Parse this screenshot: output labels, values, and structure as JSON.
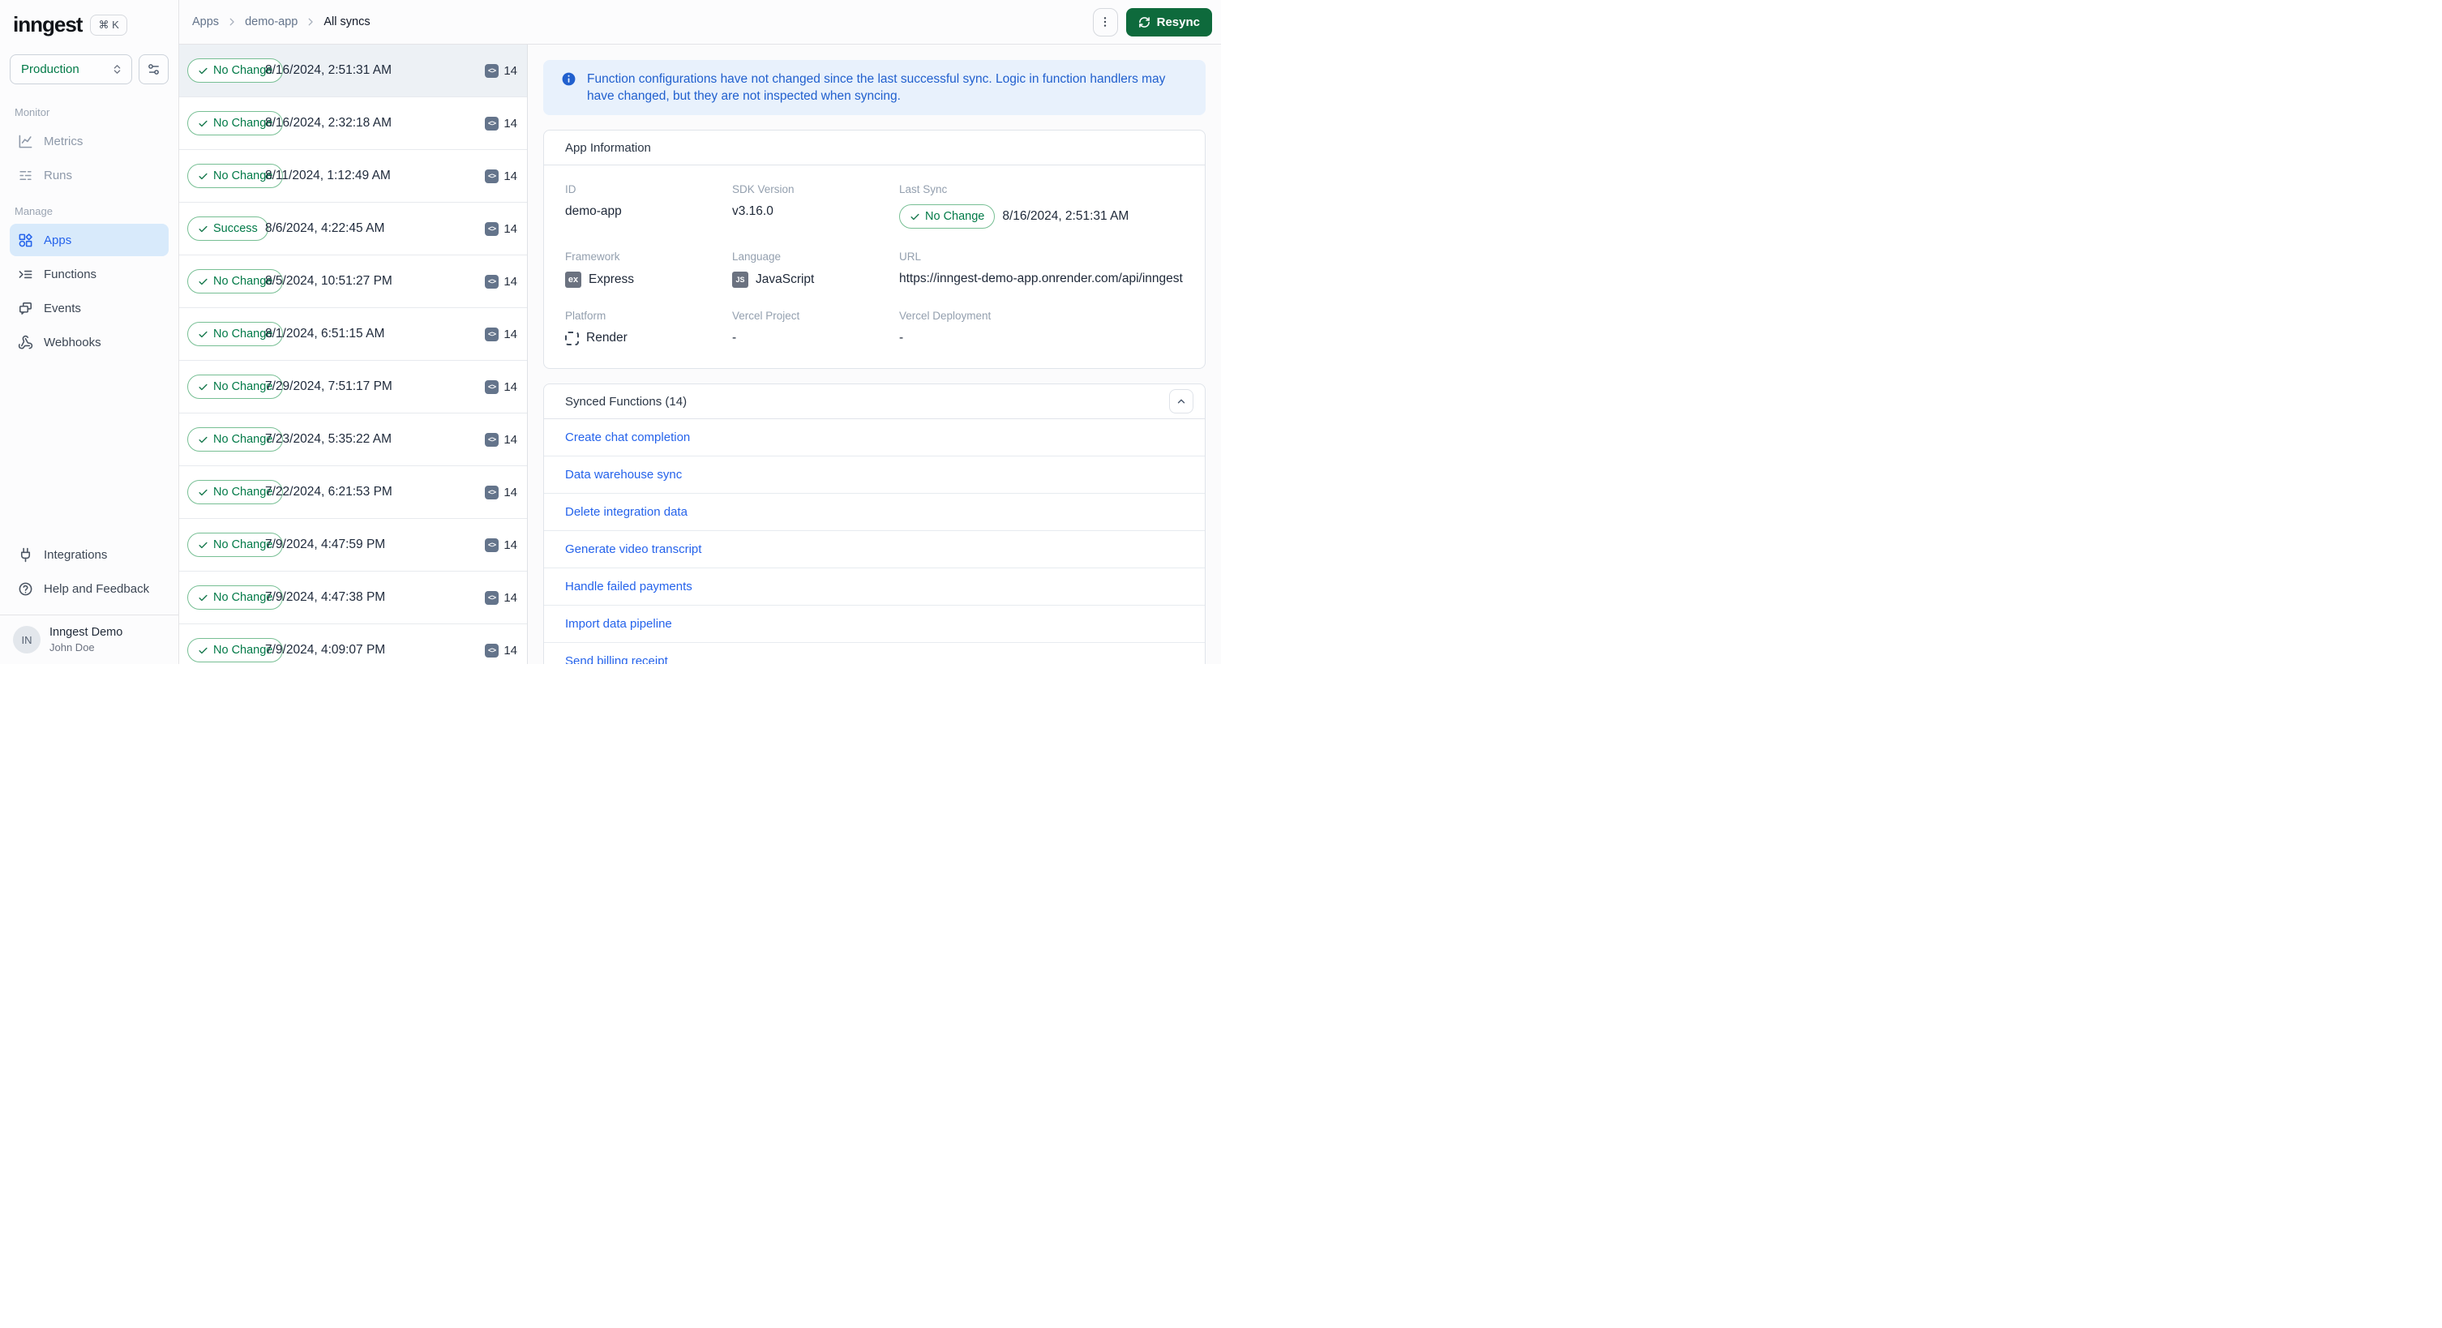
{
  "brand": {
    "logo": "inngest",
    "shortcut": "⌘ K"
  },
  "env": {
    "value": "Production"
  },
  "colors": {
    "brand_green": "#0e6a3c",
    "success_green": "#027a48",
    "active_blue": "#2563eb",
    "banner_blue": "#2160ce",
    "selected_row": "#edf1f5"
  },
  "sidebar": {
    "sections": [
      {
        "label": "Monitor",
        "items": [
          {
            "label": "Metrics",
            "icon": "metrics-icon"
          },
          {
            "label": "Runs",
            "icon": "runs-icon"
          }
        ]
      },
      {
        "label": "Manage",
        "items": [
          {
            "label": "Apps",
            "icon": "apps-icon",
            "active": true
          },
          {
            "label": "Functions",
            "icon": "functions-icon"
          },
          {
            "label": "Events",
            "icon": "events-icon"
          },
          {
            "label": "Webhooks",
            "icon": "webhook-icon"
          }
        ]
      }
    ],
    "footer_items": [
      {
        "label": "Integrations",
        "icon": "plug-icon"
      },
      {
        "label": "Help and Feedback",
        "icon": "help-icon"
      }
    ],
    "profile": {
      "initials": "IN",
      "org": "Inngest Demo",
      "user": "John Doe"
    }
  },
  "breadcrumb": {
    "items": [
      "Apps",
      "demo-app",
      "All syncs"
    ]
  },
  "actions": {
    "resync": "Resync"
  },
  "glyphs": {
    "code": "<>",
    "express": "ex",
    "js": "JS"
  },
  "syncs": [
    {
      "status": "No Change",
      "timestamp": "8/16/2024, 2:51:31 AM",
      "count": "14"
    },
    {
      "status": "No Change",
      "timestamp": "8/16/2024, 2:32:18 AM",
      "count": "14"
    },
    {
      "status": "No Change",
      "timestamp": "8/11/2024, 1:12:49 AM",
      "count": "14"
    },
    {
      "status": "Success",
      "timestamp": "8/6/2024, 4:22:45 AM",
      "count": "14"
    },
    {
      "status": "No Change",
      "timestamp": "8/5/2024, 10:51:27 PM",
      "count": "14"
    },
    {
      "status": "No Change",
      "timestamp": "8/1/2024, 6:51:15 AM",
      "count": "14"
    },
    {
      "status": "No Change",
      "timestamp": "7/29/2024, 7:51:17 PM",
      "count": "14"
    },
    {
      "status": "No Change",
      "timestamp": "7/23/2024, 5:35:22 AM",
      "count": "14"
    },
    {
      "status": "No Change",
      "timestamp": "7/22/2024, 6:21:53 PM",
      "count": "14"
    },
    {
      "status": "No Change",
      "timestamp": "7/9/2024, 4:47:59 PM",
      "count": "14"
    },
    {
      "status": "No Change",
      "timestamp": "7/9/2024, 4:47:38 PM",
      "count": "14"
    },
    {
      "status": "No Change",
      "timestamp": "7/9/2024, 4:09:07 PM",
      "count": "14"
    }
  ],
  "banner": {
    "text": "Function configurations have not changed since the last successful sync. Logic in function handlers may have changed, but they are not inspected when syncing."
  },
  "app_info": {
    "title": "App Information",
    "fields": {
      "id": {
        "label": "ID",
        "value": "demo-app"
      },
      "sdk": {
        "label": "SDK Version",
        "value": "v3.16.0"
      },
      "last_sync": {
        "label": "Last Sync",
        "badge": "No Change",
        "value": "8/16/2024, 2:51:31 AM"
      },
      "framework": {
        "label": "Framework",
        "value": "Express"
      },
      "language": {
        "label": "Language",
        "value": "JavaScript"
      },
      "url": {
        "label": "URL",
        "value": "https://inngest-demo-app.onrender.com/api/inngest"
      },
      "platform": {
        "label": "Platform",
        "value": "Render"
      },
      "vercel_project": {
        "label": "Vercel Project",
        "value": "-"
      },
      "vercel_deployment": {
        "label": "Vercel Deployment",
        "value": "-"
      }
    }
  },
  "synced_functions": {
    "title": "Synced Functions (14)",
    "items": [
      "Create chat completion",
      "Data warehouse sync",
      "Delete integration data",
      "Generate video transcript",
      "Handle failed payments",
      "Import data pipeline",
      "Send billing receipt"
    ]
  }
}
